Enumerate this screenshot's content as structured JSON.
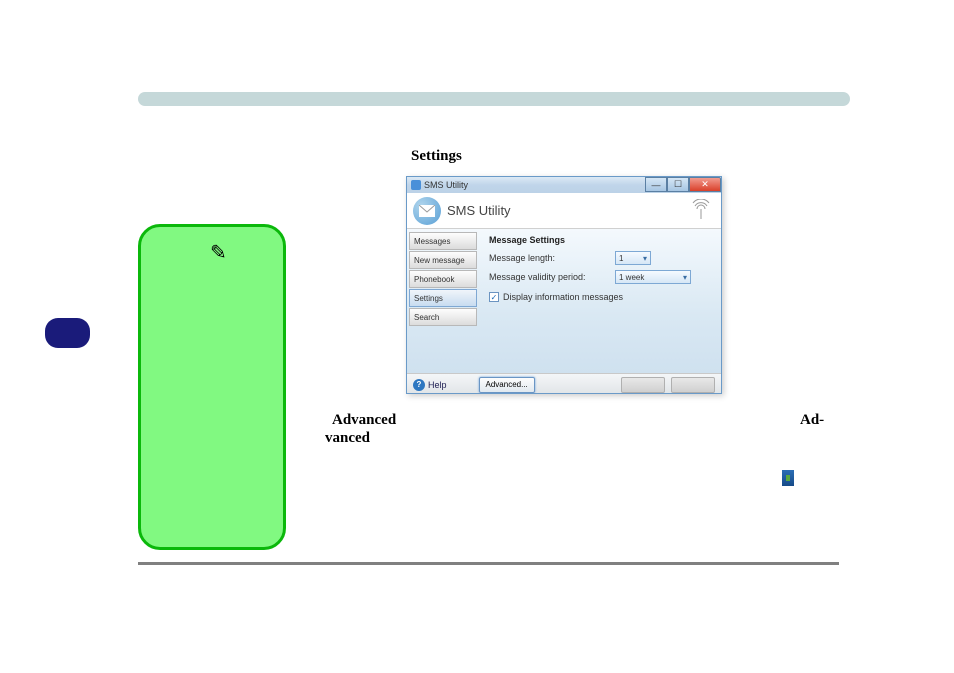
{
  "page": {
    "settings_label": "Settings",
    "line_advanced_1": "Advanced",
    "line_advanced_2": "Ad-",
    "line_advanced_3": "vanced"
  },
  "window": {
    "title": "SMS Utility",
    "app_title": "SMS Utility",
    "sidebar": [
      {
        "label": "Messages",
        "selected": false
      },
      {
        "label": "New message",
        "selected": false
      },
      {
        "label": "Phonebook",
        "selected": false
      },
      {
        "label": "Settings",
        "selected": true
      },
      {
        "label": "Search",
        "selected": false
      }
    ],
    "main": {
      "section_title": "Message Settings",
      "length_label": "Message length:",
      "length_value": "1",
      "validity_label": "Message validity period:",
      "validity_value": "1 week",
      "checkbox_label": "Display information messages",
      "checkbox_checked": true
    },
    "footer": {
      "help_label": "Help",
      "advanced_label": "Advanced..."
    }
  }
}
